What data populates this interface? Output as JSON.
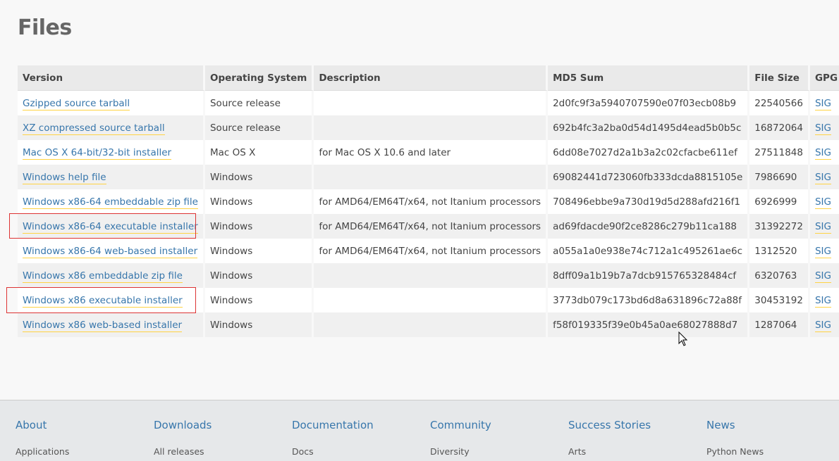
{
  "page": {
    "heading": "Files"
  },
  "table": {
    "headers": {
      "version": "Version",
      "os": "Operating System",
      "description": "Description",
      "md5": "MD5 Sum",
      "size": "File Size",
      "gpg": "GPG"
    },
    "rows": [
      {
        "version": "Gzipped source tarball",
        "os": "Source release",
        "description": "",
        "md5": "2d0fc9f3a5940707590e07f03ecb08b9",
        "size": "22540566",
        "gpg": "SIG"
      },
      {
        "version": "XZ compressed source tarball",
        "os": "Source release",
        "description": "",
        "md5": "692b4fc3a2ba0d54d1495d4ead5b0b5c",
        "size": "16872064",
        "gpg": "SIG"
      },
      {
        "version": "Mac OS X 64-bit/32-bit installer",
        "os": "Mac OS X",
        "description": "for Mac OS X 10.6 and later",
        "md5": "6dd08e7027d2a1b3a2c02cfacbe611ef",
        "size": "27511848",
        "gpg": "SIG"
      },
      {
        "version": "Windows help file",
        "os": "Windows",
        "description": "",
        "md5": "69082441d723060fb333dcda8815105e",
        "size": "7986690",
        "gpg": "SIG"
      },
      {
        "version": "Windows x86-64 embeddable zip file",
        "os": "Windows",
        "description": "for AMD64/EM64T/x64, not Itanium processors",
        "md5": "708496ebbe9a730d19d5d288afd216f1",
        "size": "6926999",
        "gpg": "SIG"
      },
      {
        "version": "Windows x86-64 executable installer",
        "os": "Windows",
        "description": "for AMD64/EM64T/x64, not Itanium processors",
        "md5": "ad69fdacde90f2ce8286c279b11ca188",
        "size": "31392272",
        "gpg": "SIG"
      },
      {
        "version": "Windows x86-64 web-based installer",
        "os": "Windows",
        "description": "for AMD64/EM64T/x64, not Itanium processors",
        "md5": "a055a1a0e938e74c712a1c495261ae6c",
        "size": "1312520",
        "gpg": "SIG"
      },
      {
        "version": "Windows x86 embeddable zip file",
        "os": "Windows",
        "description": "",
        "md5": "8dff09a1b19b7a7dcb915765328484cf",
        "size": "6320763",
        "gpg": "SIG"
      },
      {
        "version": "Windows x86 executable installer",
        "os": "Windows",
        "description": "",
        "md5": "3773db079c173bd6d8a631896c72a88f",
        "size": "30453192",
        "gpg": "SIG"
      },
      {
        "version": "Windows x86 web-based installer",
        "os": "Windows",
        "description": "",
        "md5": "f58f019335f39e0b45a0ae68027888d7",
        "size": "1287064",
        "gpg": "SIG"
      }
    ]
  },
  "footer": {
    "columns": [
      {
        "title": "About",
        "item": "Applications"
      },
      {
        "title": "Downloads",
        "item": "All releases"
      },
      {
        "title": "Documentation",
        "item": "Docs"
      },
      {
        "title": "Community",
        "item": "Diversity"
      },
      {
        "title": "Success Stories",
        "item": "Arts"
      },
      {
        "title": "News",
        "item": "Python News"
      }
    ]
  },
  "colors": {
    "link": "#3776ab",
    "link_underline": "#ffd343",
    "highlight_box": "#dd3333"
  }
}
